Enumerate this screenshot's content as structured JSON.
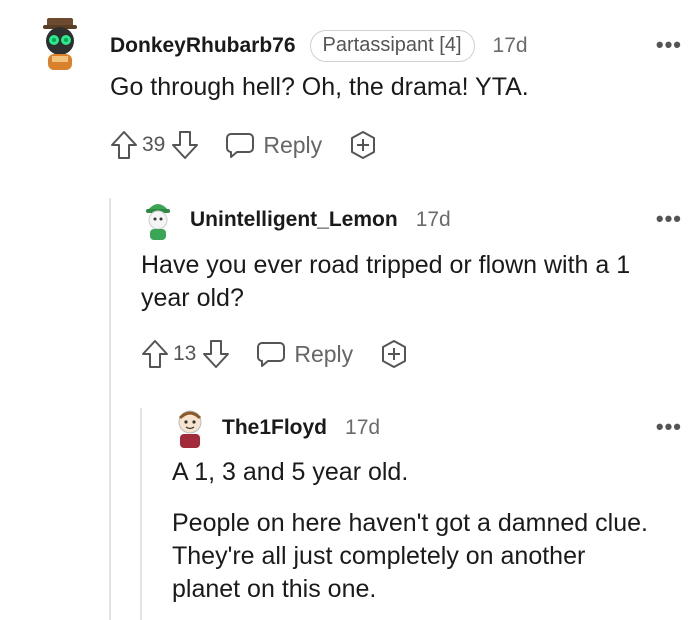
{
  "comments": [
    {
      "username": "DonkeyRhubarb76",
      "flair": "Partassipant [4]",
      "time": "17d",
      "more": "•••",
      "body": [
        "Go through hell? Oh, the drama! YTA."
      ],
      "votes": "39",
      "reply_label": "Reply",
      "avatar": "robot-snoo-avatar"
    },
    {
      "username": "Unintelligent_Lemon",
      "time": "17d",
      "more": "•••",
      "body": [
        "Have you ever road tripped or flown with a 1 year old?"
      ],
      "votes": "13",
      "reply_label": "Reply",
      "avatar": "green-hat-snoo-avatar"
    },
    {
      "username": "The1Floyd",
      "time": "17d",
      "more": "•••",
      "body": [
        "A 1, 3 and 5 year old.",
        "People on here haven't got a damned clue. They're all just completely on another planet on this one."
      ],
      "avatar": "red-shirt-snoo-avatar"
    }
  ],
  "icons": {
    "upvote": "arrow-up-icon",
    "downvote": "arrow-down-icon",
    "reply": "chat-bubble-icon",
    "award": "award-plus-icon",
    "more": "more-options-icon"
  }
}
